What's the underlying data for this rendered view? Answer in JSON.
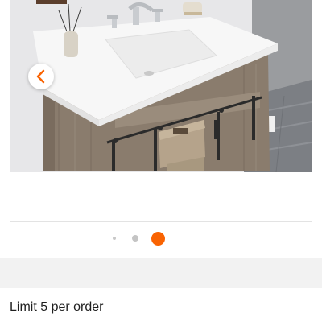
{
  "gallery": {
    "image_description_icon": "bathroom-vanity-photo",
    "prev_icon": "chevron-left-icon",
    "slide_count": 3,
    "active_slide": 3,
    "accent_color": "#f96302",
    "arrow_color": "#f96302"
  },
  "purchase": {
    "limit_text": "Limit 5 per order"
  }
}
